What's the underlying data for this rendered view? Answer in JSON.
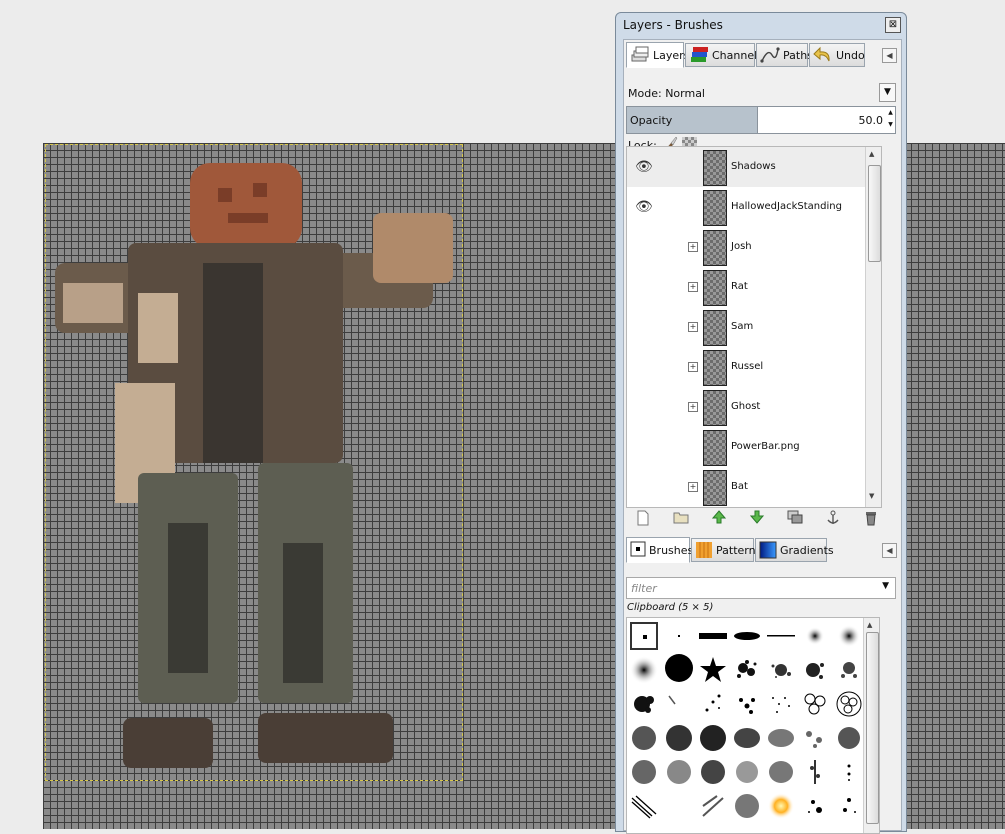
{
  "window": {
    "title": "Layers - Brushes",
    "close_glyph": "⊠"
  },
  "layers_tabs": [
    {
      "label": "Layers",
      "icon": "layers-icon"
    },
    {
      "label": "Channels",
      "icon": "channels-icon"
    },
    {
      "label": "Paths",
      "icon": "paths-icon"
    },
    {
      "label": "Undo",
      "icon": "undo-icon"
    }
  ],
  "mode": {
    "label": "Mode:",
    "value": "Normal"
  },
  "opacity": {
    "label": "Opacity",
    "value": "50.0",
    "fraction": 0.5
  },
  "lock": {
    "label": "Lock:"
  },
  "layers": [
    {
      "name": "Shadows",
      "visible": true,
      "expandable": false,
      "selected": true
    },
    {
      "name": "HallowedJackStanding",
      "visible": true,
      "expandable": false,
      "selected": false
    },
    {
      "name": "Josh",
      "visible": false,
      "expandable": true,
      "selected": false
    },
    {
      "name": "Rat",
      "visible": false,
      "expandable": true,
      "selected": false
    },
    {
      "name": "Sam",
      "visible": false,
      "expandable": true,
      "selected": false
    },
    {
      "name": "Russel",
      "visible": false,
      "expandable": true,
      "selected": false
    },
    {
      "name": "Ghost",
      "visible": false,
      "expandable": true,
      "selected": false
    },
    {
      "name": "PowerBar.png",
      "visible": false,
      "expandable": false,
      "selected": false
    },
    {
      "name": "Bat",
      "visible": false,
      "expandable": true,
      "selected": false
    }
  ],
  "layer_buttons": [
    "new-layer",
    "new-layer-group",
    "raise-layer",
    "lower-layer",
    "duplicate-layer",
    "anchor-layer",
    "delete-layer"
  ],
  "brushes_tabs": [
    {
      "label": "Brushes",
      "icon": "brushes-icon"
    },
    {
      "label": "Patterns",
      "icon": "patterns-icon"
    },
    {
      "label": "Gradients",
      "icon": "gradients-icon"
    }
  ],
  "filter": {
    "placeholder": "filter"
  },
  "brush_caption": "Clipboard (5 × 5)",
  "colors": {
    "canvas": "#8a8a8a",
    "selection_bg": "#b7c2cc",
    "titlebar": "#cfdbe8"
  }
}
